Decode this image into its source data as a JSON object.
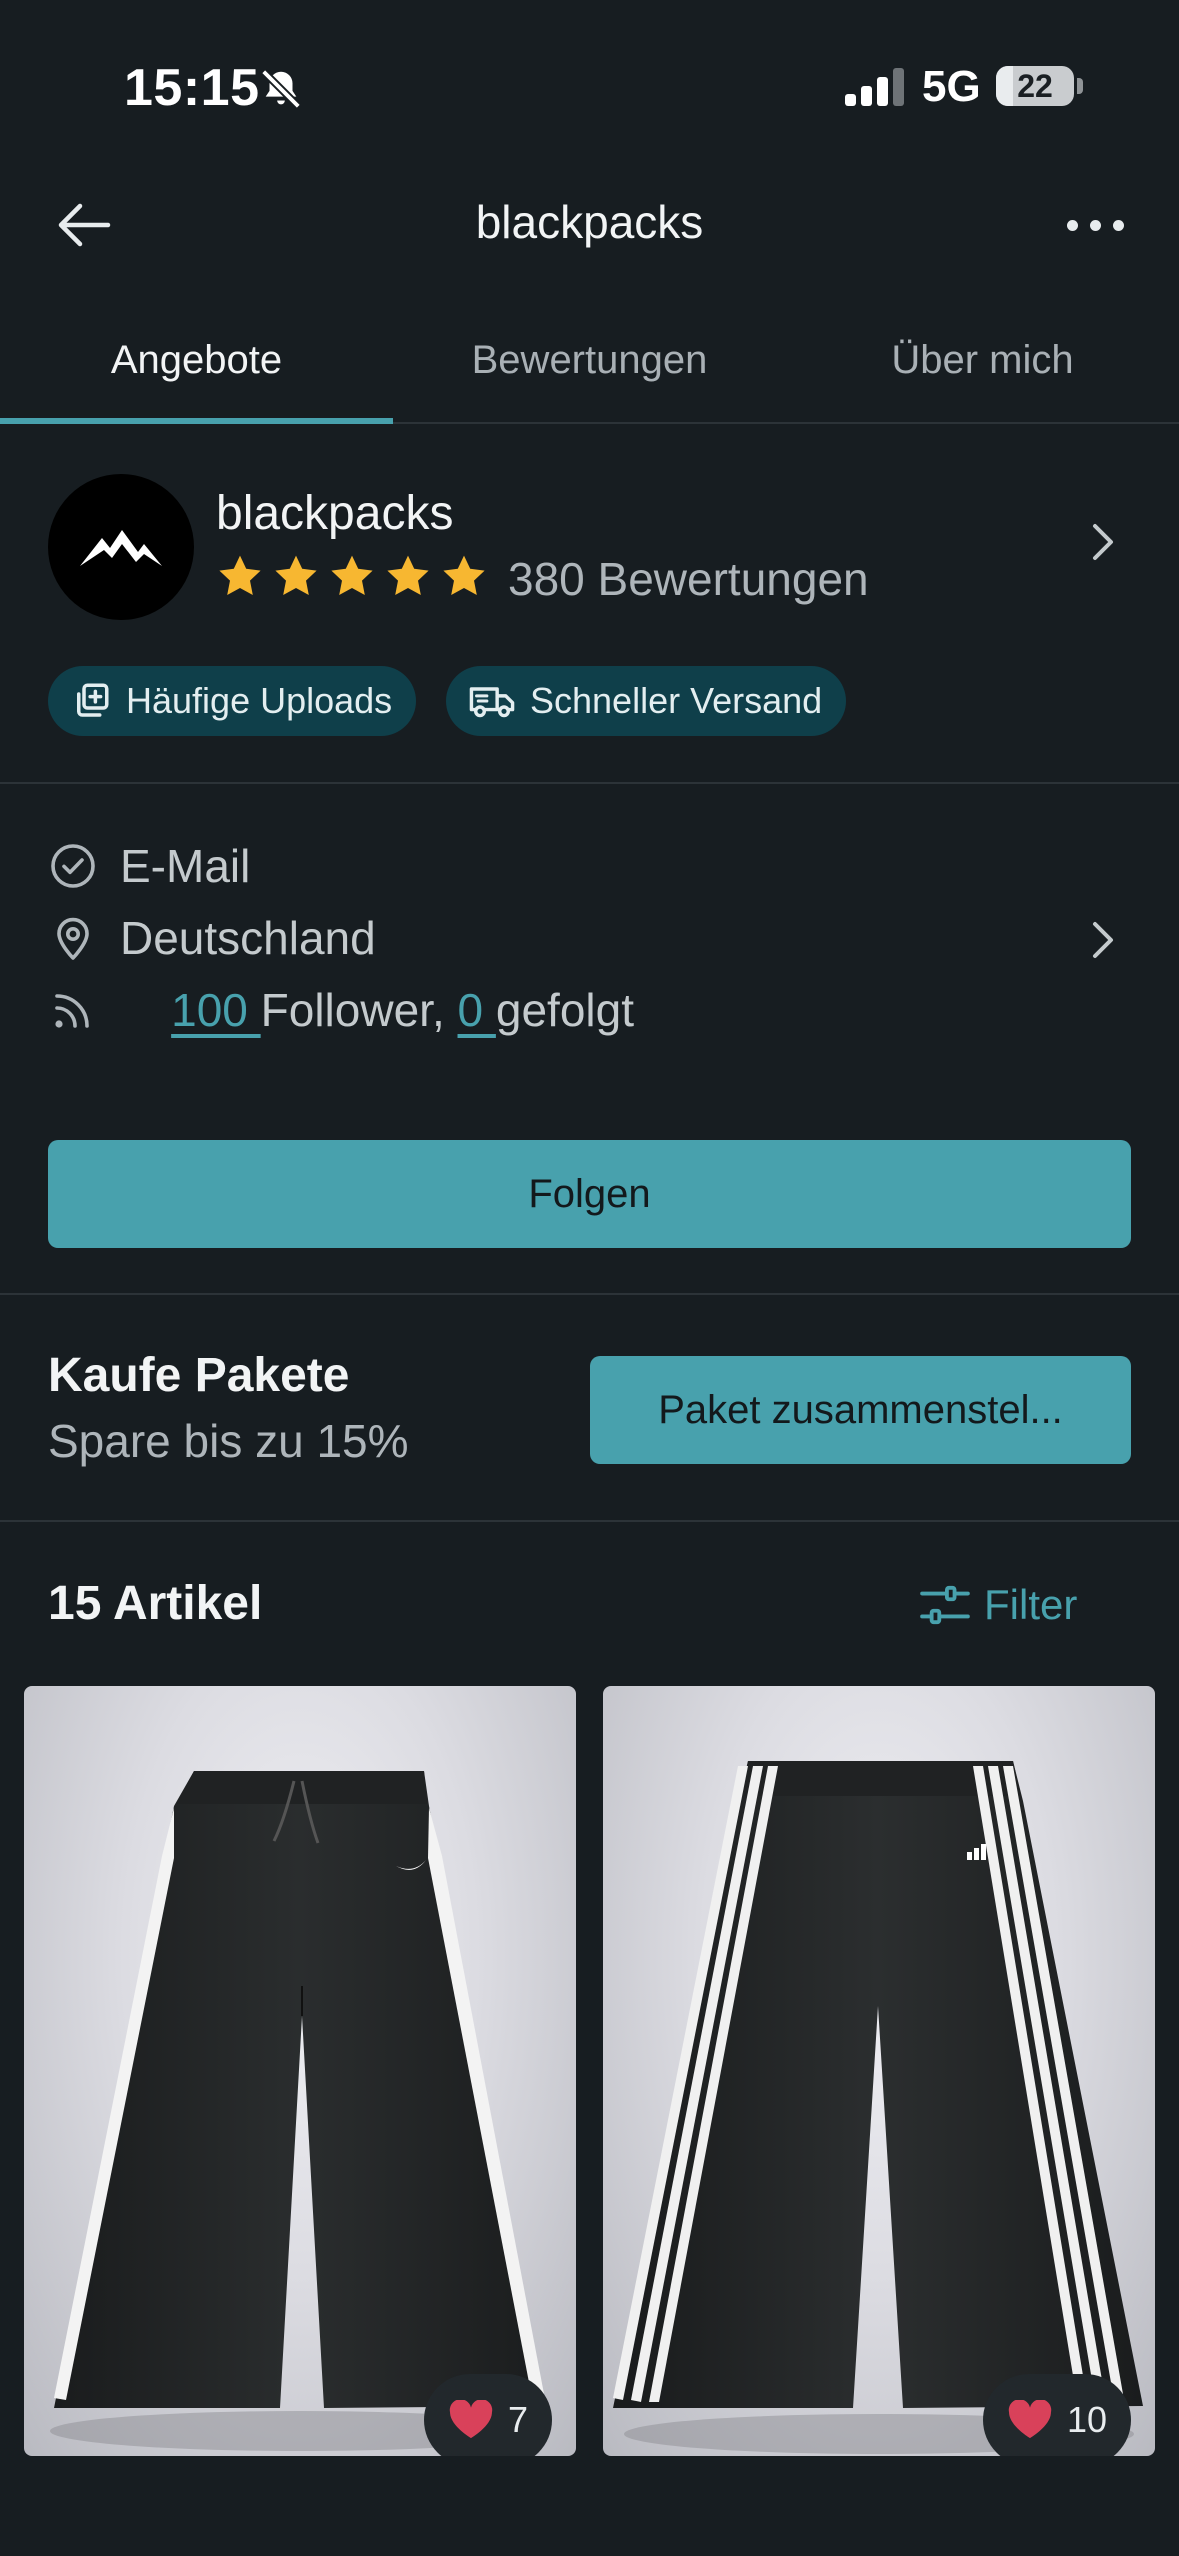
{
  "status_bar": {
    "time": "15:15",
    "network": "5G",
    "battery": "22",
    "battery_level": 0.22
  },
  "header": {
    "title": "blackpacks"
  },
  "tabs": [
    {
      "label": "Angebote",
      "active": true
    },
    {
      "label": "Bewertungen",
      "active": false
    },
    {
      "label": "Über mich",
      "active": false
    }
  ],
  "profile": {
    "name": "blackpacks",
    "stars": 5,
    "rating_count": "380 Bewertungen",
    "badges": [
      {
        "label": "Häufige Uploads",
        "icon": "uploads-icon"
      },
      {
        "label": "Schneller Versand",
        "icon": "truck-icon"
      }
    ]
  },
  "info": {
    "email": "E-Mail",
    "location": "Deutschland",
    "followers_count": "100 ",
    "followers_label": "Follower, ",
    "following_count": "0 ",
    "following_label": "gefolgt"
  },
  "follow_button": "Folgen",
  "bundle": {
    "title": "Kaufe Pakete",
    "subtitle": "Spare bis zu 15%",
    "button": "Paket zusammenstel..."
  },
  "items": {
    "count_label": "15 Artikel",
    "filter_label": "Filter",
    "list": [
      {
        "likes": "7",
        "brand_mark": "swoosh"
      },
      {
        "likes": "10",
        "brand_mark": "three-stripes"
      }
    ]
  },
  "colors": {
    "background": "#171d21",
    "accent": "#48a1ad",
    "badge_bg": "#0f3f4a",
    "star": "#f7b731",
    "heart": "#d9415a"
  }
}
